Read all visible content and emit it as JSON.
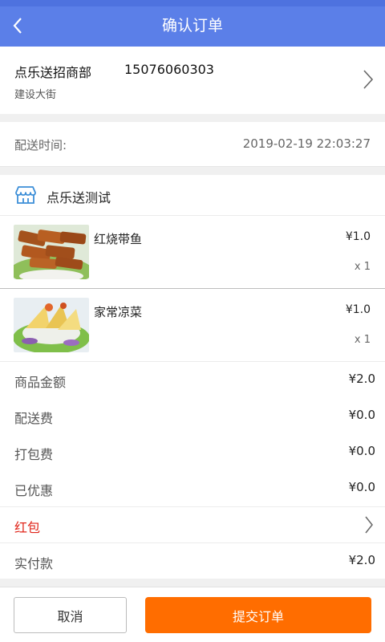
{
  "header": {
    "title": "确认订单"
  },
  "address": {
    "name": "点乐送招商部",
    "phone": "15076060303",
    "street": "建设大街"
  },
  "delivery": {
    "label": "配送时间:",
    "time": "2019-02-19 22:03:27"
  },
  "shop": {
    "name": "点乐送测试"
  },
  "items": [
    {
      "name": "红烧带鱼",
      "price": "¥1.0",
      "qty": "x 1"
    },
    {
      "name": "家常凉菜",
      "price": "¥1.0",
      "qty": "x 1"
    }
  ],
  "summary": {
    "goods_amount": {
      "label": "商品金额",
      "value": "¥2.0"
    },
    "delivery_fee": {
      "label": "配送费",
      "value": "¥0.0"
    },
    "packing_fee": {
      "label": "打包费",
      "value": "¥0.0"
    },
    "discount": {
      "label": "已优惠",
      "value": "¥0.0"
    },
    "red_packet": {
      "label": "红包"
    },
    "paid": {
      "label": "实付款",
      "value": "¥2.0"
    }
  },
  "footer": {
    "cancel_label": "取消",
    "submit_label": "提交订单"
  },
  "colors": {
    "header_bg": "#5b7fe8",
    "accent": "#ff6d00",
    "red_packet": "#e0261b"
  }
}
